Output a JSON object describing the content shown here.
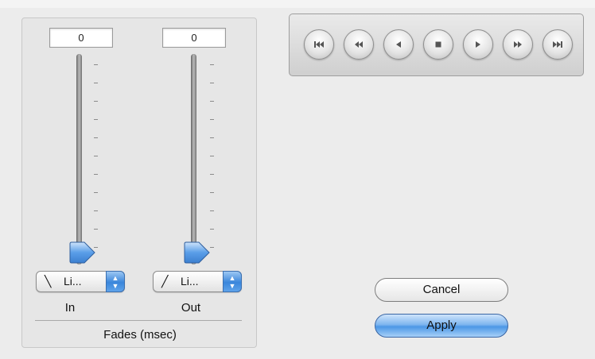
{
  "fades": {
    "group_label": "Fades (msec)",
    "fade_in": {
      "value": "0",
      "slider_level": 0,
      "curve_glyph": "╲",
      "curve_label": "Li...",
      "label": "In"
    },
    "fade_out": {
      "value": "0",
      "slider_level": 0,
      "curve_glyph": "╱",
      "curve_label": "Li...",
      "label": "Out"
    }
  },
  "transport": {
    "buttons": [
      "skip-to-start-icon",
      "rewind-icon",
      "play-reverse-icon",
      "stop-icon",
      "play-icon",
      "fast-forward-icon",
      "skip-to-end-icon"
    ]
  },
  "actions": {
    "cancel_label": "Cancel",
    "apply_label": "Apply"
  },
  "colors": {
    "accent": "#4c97e6",
    "background": "#ececec"
  }
}
